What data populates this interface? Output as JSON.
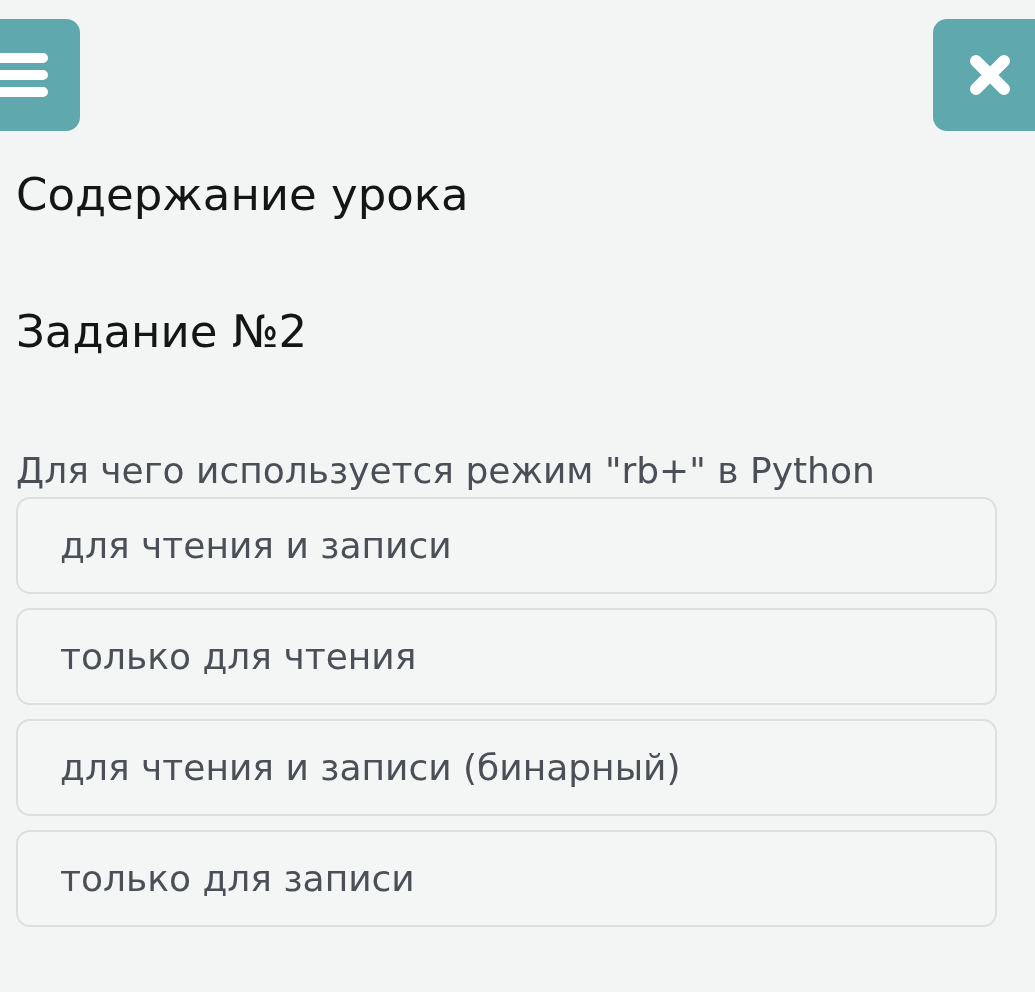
{
  "header": {
    "title": "Содержание урока"
  },
  "task": {
    "heading": "Задание №2",
    "question": "Для чего используется режим \"rb+\" в Python",
    "options": [
      {
        "text": "для чтения и записи"
      },
      {
        "text": "только для чтения"
      },
      {
        "text": "для чтения и записи (бинарный)"
      },
      {
        "text": "только для записи"
      }
    ]
  }
}
